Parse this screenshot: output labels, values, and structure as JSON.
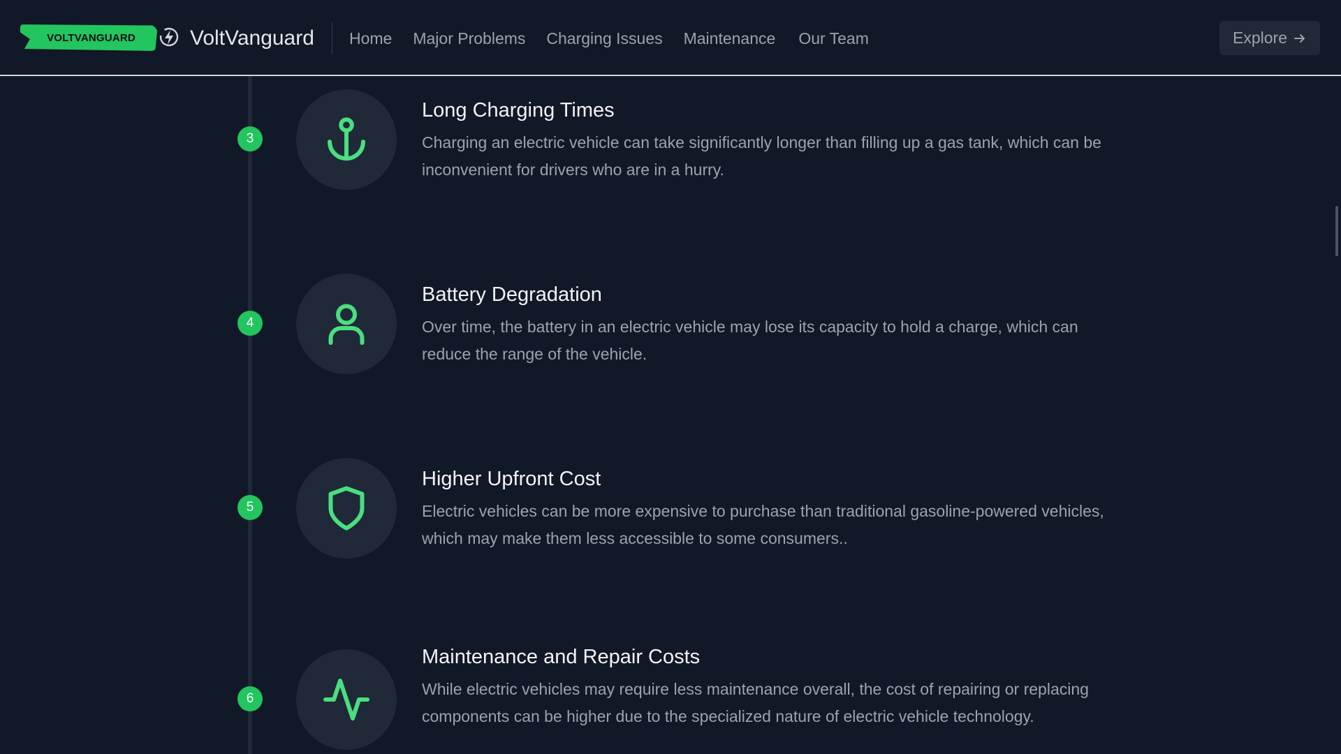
{
  "header": {
    "logo_text": "VOLTVANGUARD",
    "brand_name": "VoltVanguard",
    "nav": [
      {
        "label": "Home"
      },
      {
        "label": "Major Problems"
      },
      {
        "label": "Charging Issues"
      },
      {
        "label": "Maintenance"
      },
      {
        "label": "Our Team"
      }
    ],
    "explore_label": "Explore",
    "explore_icon": "arrow-right-icon",
    "brand_icon": "bolt-icon"
  },
  "timeline": {
    "items": [
      {
        "number": "3",
        "icon": "anchor-icon",
        "title": "Long Charging Times",
        "description": "Charging an electric vehicle can take significantly longer than filling up a gas tank, which can be inconvenient for drivers who are in a hurry."
      },
      {
        "number": "4",
        "icon": "user-icon",
        "title": "Battery Degradation",
        "description": "Over time, the battery in an electric vehicle may lose its capacity to hold a charge, which can reduce the range of the vehicle."
      },
      {
        "number": "5",
        "icon": "shield-icon",
        "title": "Higher Upfront Cost",
        "description": "Electric vehicles can be more expensive to purchase than traditional gasoline-powered vehicles, which may make them less accessible to some consumers.."
      },
      {
        "number": "6",
        "icon": "activity-icon",
        "title": "Maintenance and Repair Costs",
        "description": "While electric vehicles may require less maintenance overall, the cost of repairing or replacing components can be higher due to the specialized nature of electric vehicle technology."
      }
    ]
  },
  "colors": {
    "background": "#111827",
    "accent": "#22c55e",
    "icon_stroke": "#4ade80",
    "circle_bg": "#1f2937",
    "muted_text": "#9ca3af"
  }
}
